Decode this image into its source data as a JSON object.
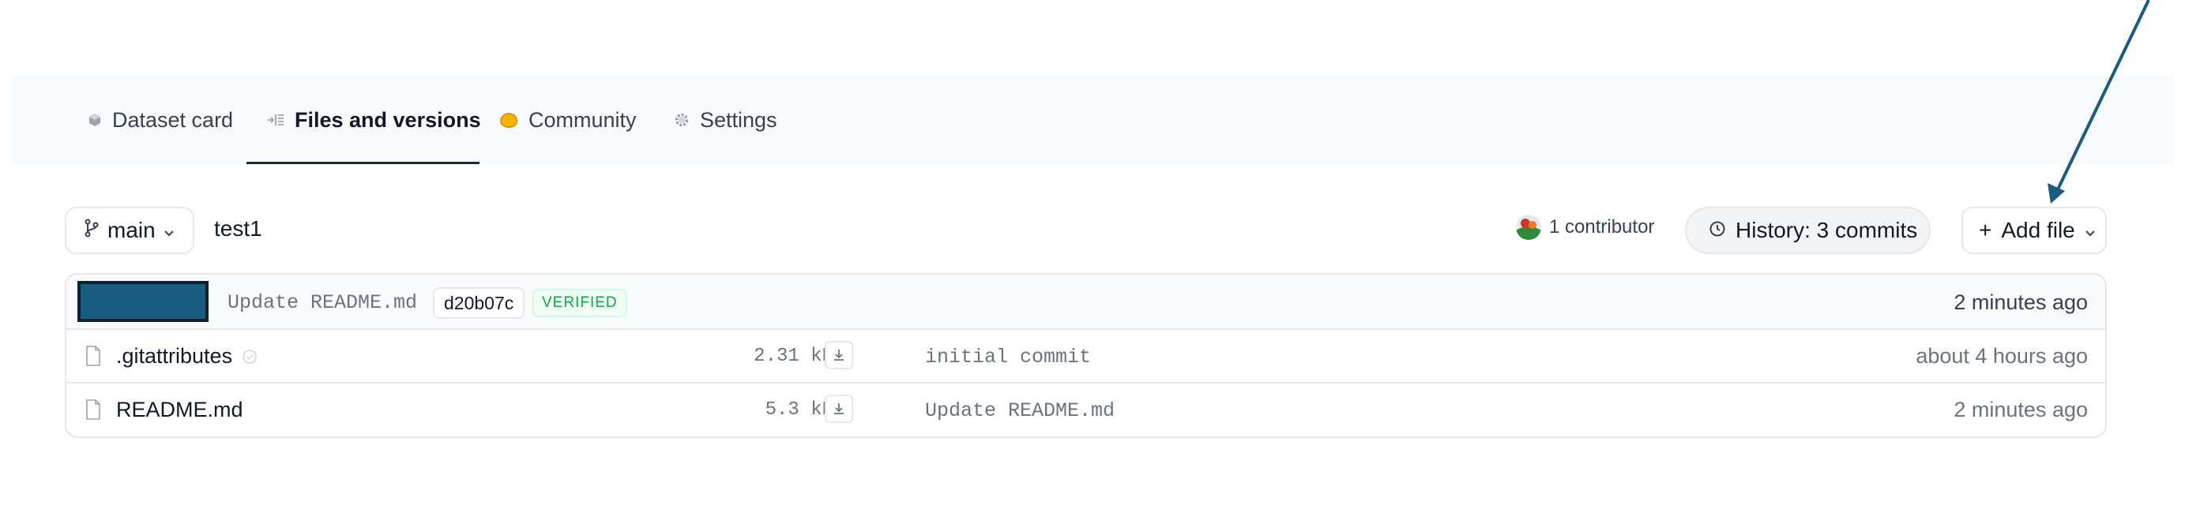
{
  "tabs": [
    {
      "label": "Dataset card",
      "icon": "dataset-card-icon",
      "active": false
    },
    {
      "label": "Files and versions",
      "icon": "files-icon",
      "active": true
    },
    {
      "label": "Community",
      "icon": "community-icon",
      "active": false
    },
    {
      "label": "Settings",
      "icon": "gear-icon",
      "active": false
    }
  ],
  "branch": {
    "name": "main",
    "icon": "git-branch-icon"
  },
  "repo_folder": "test1",
  "contributors": {
    "label": "1 contributor"
  },
  "history": {
    "label": "History: 3 commits"
  },
  "add_file": {
    "label": "Add file",
    "prefix": "+"
  },
  "last_commit": {
    "message": "Update README.md",
    "hash": "d20b07c",
    "badge": "VERIFIED",
    "time": "2 minutes ago"
  },
  "files": [
    {
      "name": ".gitattributes",
      "size": "2.31 kB",
      "commit": "initial commit",
      "time": "about 4 hours ago",
      "safe_badge": true
    },
    {
      "name": "README.md",
      "size": "5.3 kB",
      "commit": "Update README.md",
      "time": "2 minutes ago",
      "safe_badge": false
    }
  ],
  "colors": {
    "accent": "#1a5b80",
    "verified_green": "#16a34a",
    "community_yellow": "#f5b400",
    "annotation_arrow": "#1a5b80"
  }
}
